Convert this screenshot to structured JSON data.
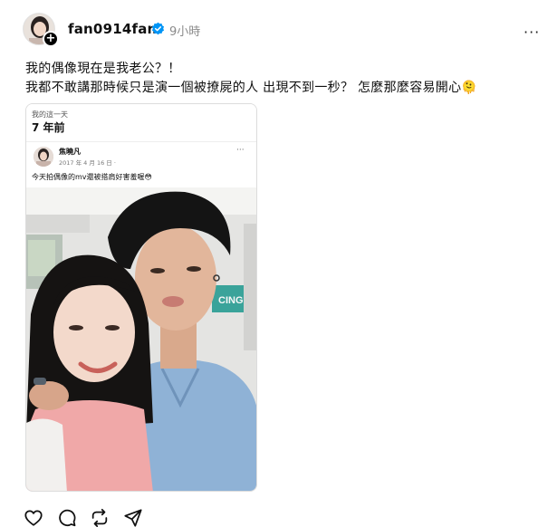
{
  "post": {
    "username": "fan0914fan",
    "time": "9小時",
    "caption_lines": [
      "我的偶像現在是我老公？！",
      "我都不敢講那時候只是演一個被撩屍的人 出現不到一秒？ 怎麼那麼容易開心🫠"
    ],
    "more_glyph": "···",
    "follow_glyph": "+"
  },
  "memory": {
    "label": "我的這一天",
    "years": "7 年前"
  },
  "fb_post": {
    "name": "焦曉凡",
    "date": "2017 年 4 月 16 日 · ",
    "text": "今天拍偶像的mv還被搭肩好害羞喔😳",
    "more_glyph": "···"
  },
  "photo": {
    "sign_text": "CING"
  },
  "actions": [
    "like-icon",
    "comment-icon",
    "repost-icon",
    "share-icon"
  ],
  "colors": {
    "verified": "#0095f6",
    "text": "#101010",
    "muted": "#8a8a8a"
  }
}
